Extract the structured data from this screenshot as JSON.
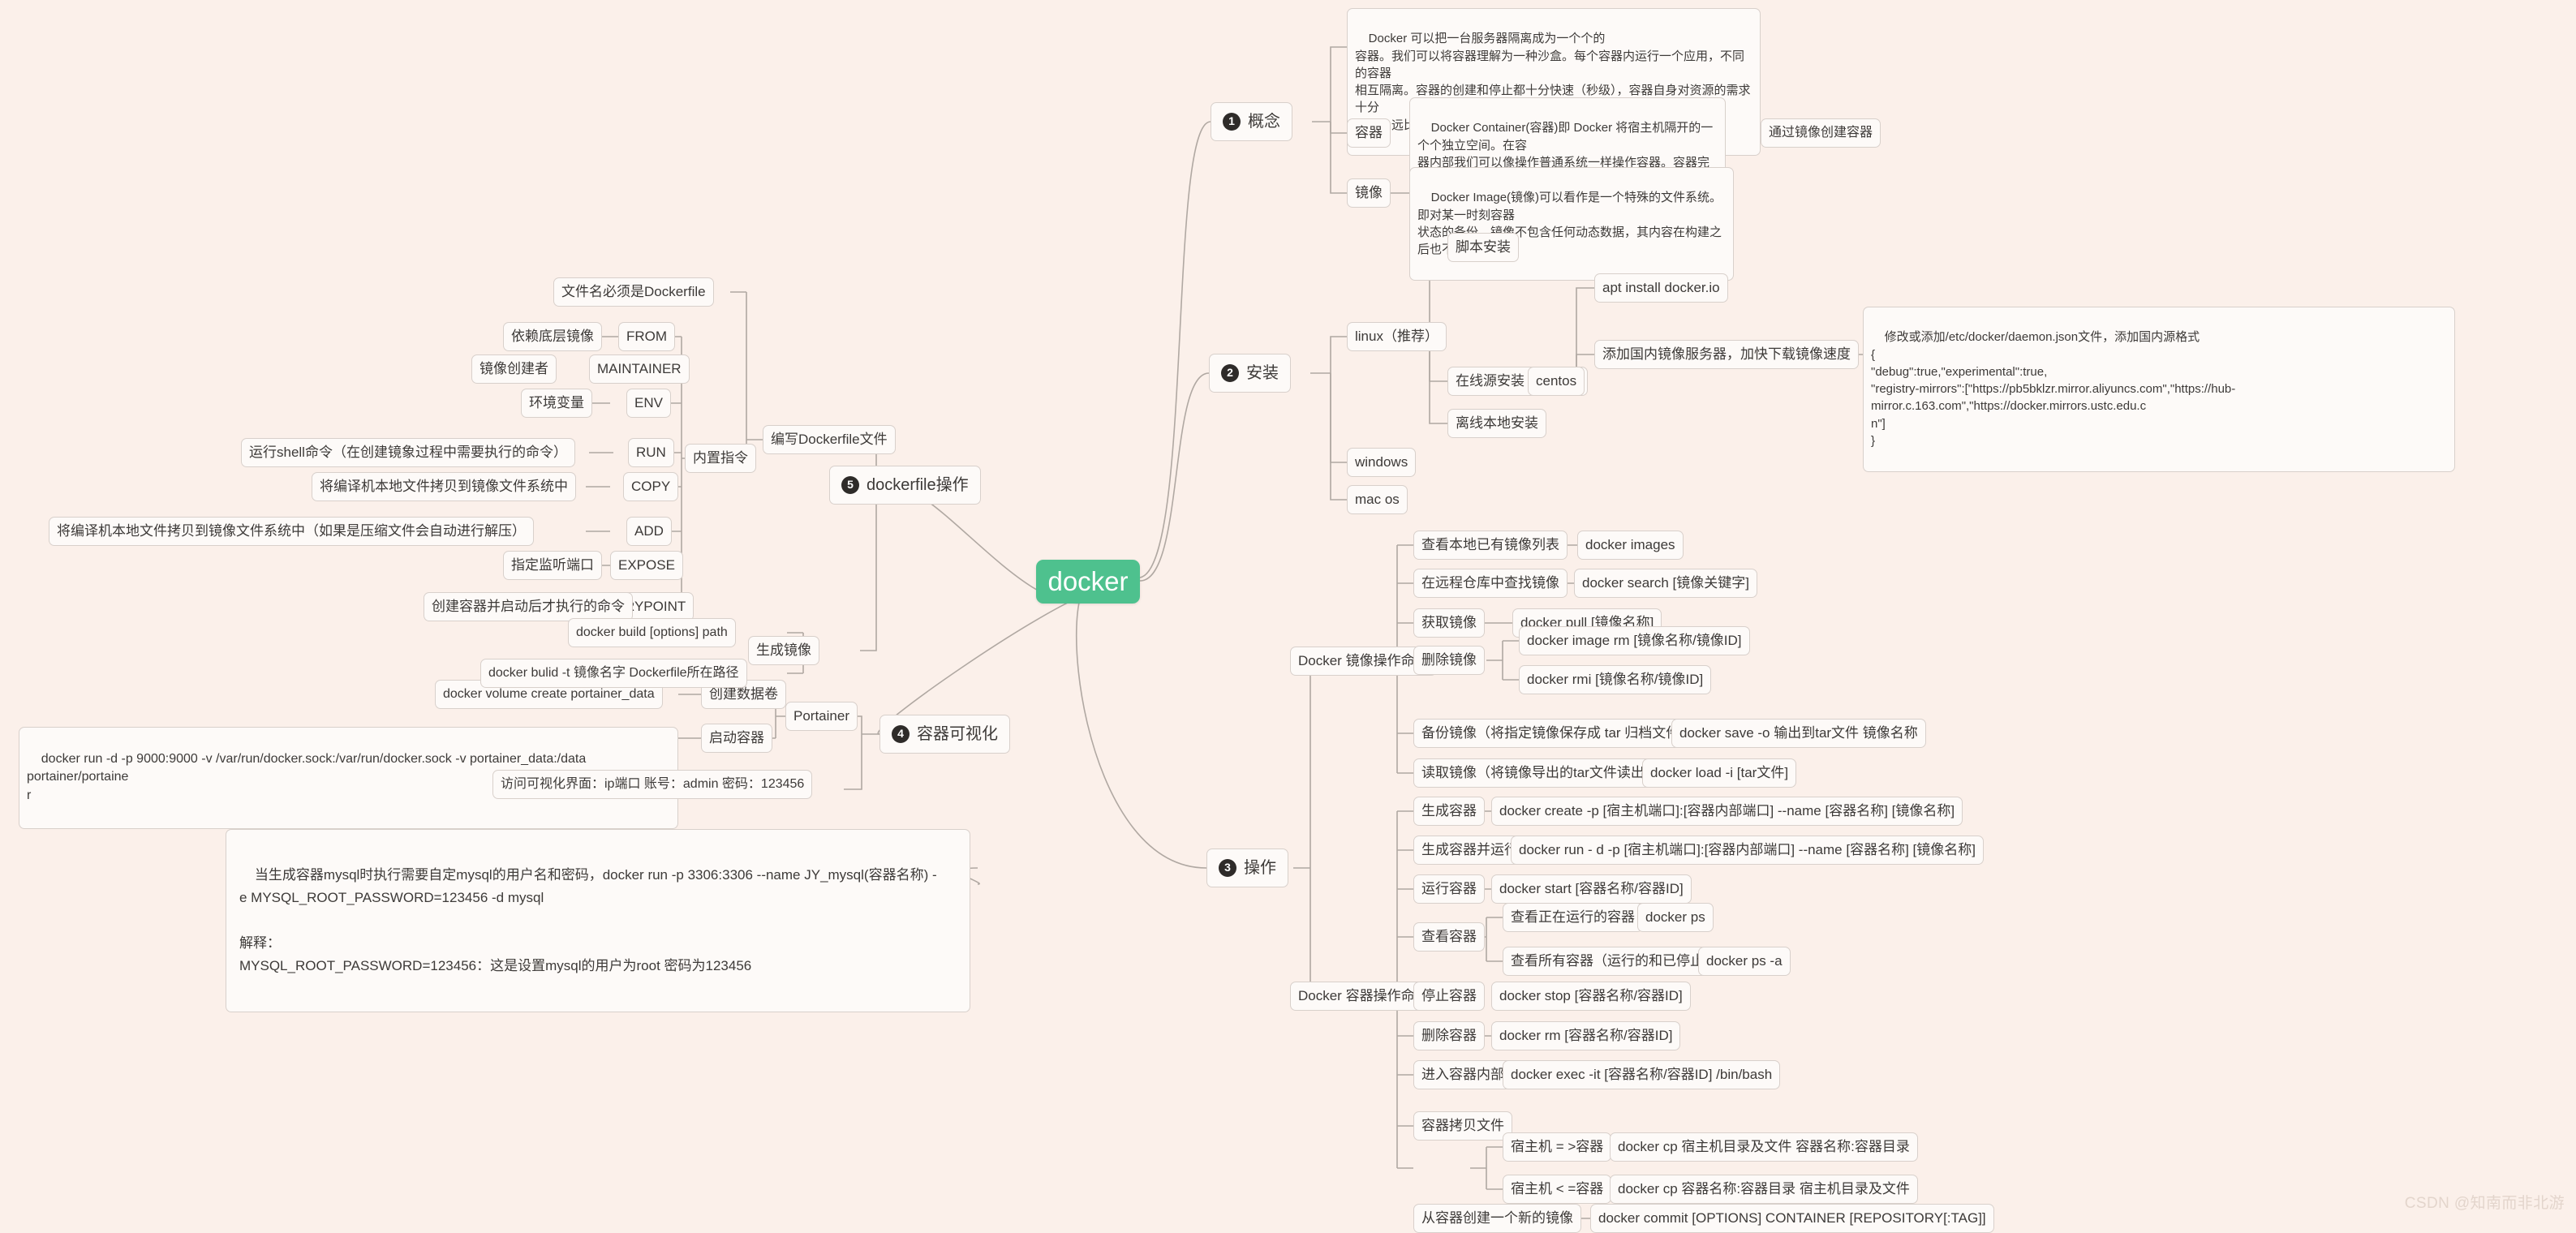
{
  "root": {
    "label": "docker",
    "color": "#4ec18e"
  },
  "watermark": "CSDN @知南而非北游",
  "branches": {
    "concept": {
      "num": "1",
      "label": "概念",
      "intro": "Docker 可以把一台服务器隔离成为一个个的\n容器。我们可以将容器理解为一种沙盒。每个容器内运行一个应用，不同的容器\n相互隔离。容器的创建和停止都十分快速（秒级），容器自身对资源的需求十分\n有限，远比虚拟机本身占用的资源少。",
      "container_label": "容器",
      "container_desc": "Docker Container(容器)即 Docker 将宿主机隔开的一个个独立空间。在容\n器内部我们可以像操作普通系统一样操作容器。容器完全使用沙箱机制，相互之\n间不会有任何接口，几乎没有性能开销,可以很容易地在机器和数据中心中运行。",
      "container_child": "通过镜像创建容器",
      "image_label": "镜像",
      "image_desc": "Docker Image(镜像)可以看作是一个特殊的文件系统。即对某一时刻容器\n状态的备份。镜像不包含任何动态数据，其内容在构建之后也不会被改变。"
    },
    "install": {
      "num": "2",
      "label": "安装",
      "linux": "linux（推荐）",
      "script_install": "脚本安装",
      "online_install": "在线源安装（推荐）",
      "offline_install": "离线本地安装",
      "centos": "centos",
      "apt": "apt install docker.io",
      "mirror": "添加国内镜像服务器，加快下载镜像速度",
      "daemon_json": "修改或添加/etc/docker/daemon.json文件，添加国内源格式\n{\n\"debug\":true,\"experimental\":true,\n\"registry-mirrors\":[\"https://pb5bklzr.mirror.aliyuncs.com\",\"https://hub-mirror.c.163.com\",\"https://docker.mirrors.ustc.edu.c\nn\"]\n}",
      "windows": "windows",
      "macos": "mac os"
    },
    "operation": {
      "num": "3",
      "label": "操作",
      "image_cmd_group": "Docker 镜像操作命令",
      "container_cmd_group": "Docker 容器操作命令",
      "image_cmds": [
        {
          "label": "查看本地已有镜像列表",
          "cmds": [
            "docker images"
          ]
        },
        {
          "label": "在远程仓库中查找镜像",
          "cmds": [
            "docker search [镜像关键字]"
          ]
        },
        {
          "label": "获取镜像",
          "cmds": [
            "docker pull [镜像名称]"
          ]
        },
        {
          "label": "删除镜像",
          "cmds": [
            "docker image rm [镜像名称/镜像ID]",
            "docker rmi [镜像名称/镜像ID]"
          ]
        },
        {
          "label": "备份镜像（将指定镜像保存成 tar 归档文件）",
          "cmds": [
            "docker save -o 输出到tar文件 镜像名称"
          ]
        },
        {
          "label": "读取镜像（将镜像导出的tar文件读出成image）",
          "cmds": [
            "docker load -i [tar文件]"
          ]
        }
      ],
      "container_cmds": [
        {
          "label": "生成容器",
          "cmds": [
            "docker create -p [宿主机端口]:[容器内部端口] --name [容器名称] [镜像名称]"
          ]
        },
        {
          "label": "生成容器并运行",
          "cmds": [
            "docker run  - d -p [宿主机端口]:[容器内部端口] --name [容器名称] [镜像名称]"
          ]
        },
        {
          "label": "运行容器",
          "cmds": [
            "docker start [容器名称/容器ID]"
          ]
        },
        {
          "label": "查看容器",
          "cmds": []
        },
        {
          "label": "停止容器",
          "cmds": [
            "docker stop [容器名称/容器ID]"
          ]
        },
        {
          "label": "删除容器",
          "cmds": [
            "docker rm [容器名称/容器ID]"
          ]
        },
        {
          "label": "进入容器内部",
          "cmds": [
            "docker exec -it [容器名称/容器ID] /bin/bash"
          ]
        },
        {
          "label": "容器拷贝文件",
          "cmds": []
        },
        {
          "label": "从容器创建一个新的镜像",
          "cmds": [
            "docker commit [OPTIONS] CONTAINER [REPOSITORY[:TAG]]"
          ]
        }
      ],
      "view_running": "查看正在运行的容器",
      "view_running_cmd": "docker ps",
      "view_all": "查看所有容器（运行的和已停止的）",
      "view_all_cmd": "docker ps -a",
      "cp_to_container": "宿主机 = >容器",
      "cp_to_container_cmd": "docker cp 宿主机目录及文件 容器名称:容器目录",
      "cp_from_container": "宿主机 < =容器",
      "cp_from_container_cmd": "docker cp 容器名称:容器目录 宿主机目录及文件",
      "mysql_note": "当生成容器mysql时执行需要自定mysql的用户名和密码，docker run -p 3306:3306 --name JY_mysql(容器名称) -\ne MYSQL_ROOT_PASSWORD=123456 -d mysql\n\n解释：\nMYSQL_ROOT_PASSWORD=123456：这是设置mysql的用户为root 密码为123456"
    },
    "visualization": {
      "num": "4",
      "label": "容器可视化",
      "portainer": "Portainer",
      "create_volume": "创建数据卷",
      "create_volume_cmd": "docker volume create portainer_data",
      "start_container": "启动容器",
      "start_container_cmd": "docker run -d -p 9000:9000 -v /var/run/docker.sock:/var/run/docker.sock -v portainer_data:/data portainer/portaine\nr",
      "access": "访问可视化界面：ip端口 账号：admin  密码：123456"
    },
    "dockerfile": {
      "num": "5",
      "label": "dockerfile操作",
      "write_file": "编写Dockerfile文件",
      "filename_rule": "文件名必须是Dockerfile",
      "builtin_label": "内置指令",
      "instructions": [
        {
          "desc": "依赖底层镜像",
          "kw": "FROM"
        },
        {
          "desc": "镜像创建者",
          "kw": "MAINTAINER"
        },
        {
          "desc": "环境变量",
          "kw": "ENV"
        },
        {
          "desc": "运行shell命令（在创建镜象过程中需要执行的命令）",
          "kw": "RUN"
        },
        {
          "desc": "将编译机本地文件拷贝到镜像文件系统中",
          "kw": "COPY"
        },
        {
          "desc": "将编译机本地文件拷贝到镜像文件系统中（如果是压缩文件会自动进行解压）",
          "kw": "ADD"
        },
        {
          "desc": "指定监听端口",
          "kw": "EXPOSE"
        },
        {
          "desc": "创建容器并启动后才执行的命令",
          "kw": "ENTRYPOINT"
        }
      ],
      "gen_image": "生成镜像",
      "gen_image_cmds": [
        "docker build [options] path",
        "docker bulid -t 镜像名字  Dockerfile所在路径"
      ]
    }
  }
}
